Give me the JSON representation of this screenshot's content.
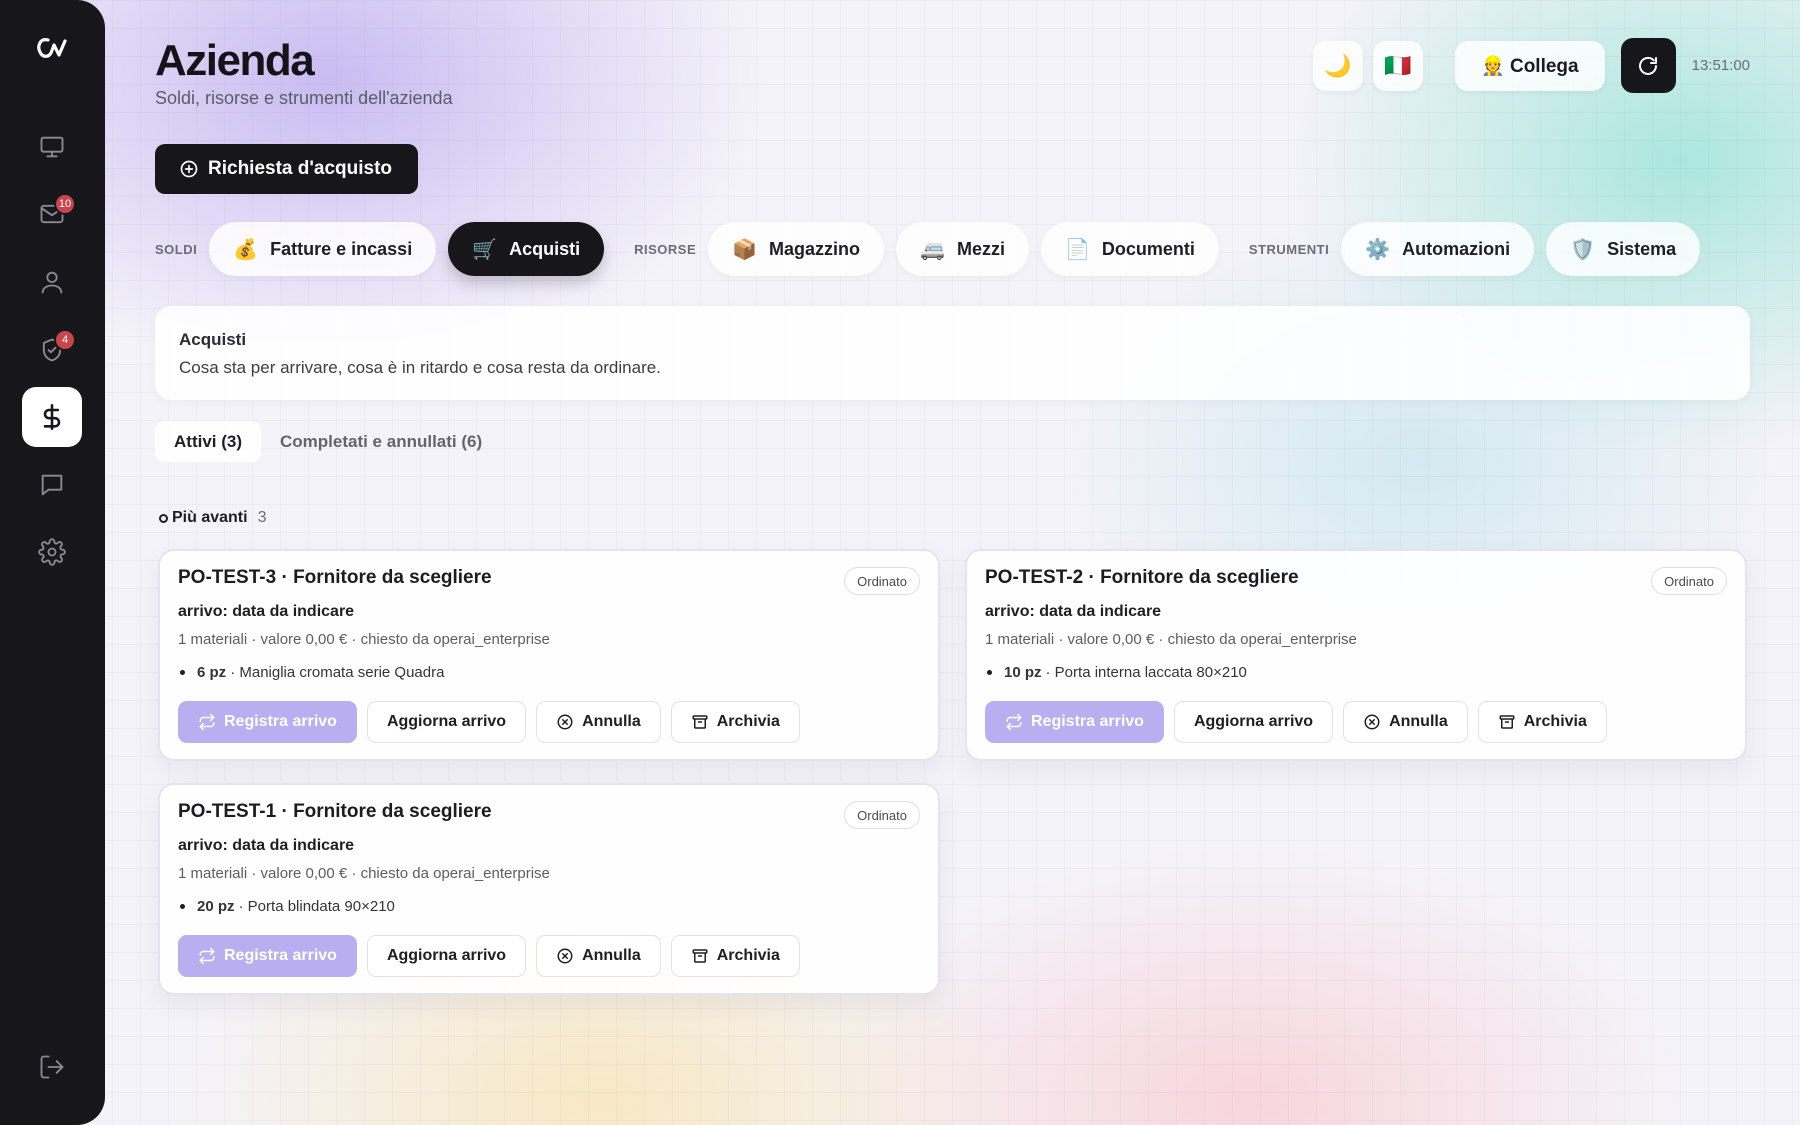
{
  "header": {
    "title": "Azienda",
    "subtitle": "Soldi, risorse e strumenti dell'azienda",
    "theme_icon": "moon-icon",
    "language_flag": "🇮🇹",
    "connect_label": "👷 Collega",
    "time": "13:51:00"
  },
  "sidebar": {
    "items": [
      {
        "name": "monitor-icon"
      },
      {
        "name": "mail-icon",
        "badge": "10"
      },
      {
        "name": "user-icon"
      },
      {
        "name": "shield-check-icon",
        "badge": "4"
      },
      {
        "name": "dollar-icon",
        "active": true
      },
      {
        "name": "chat-icon"
      },
      {
        "name": "gear-icon"
      }
    ],
    "logout_icon": "logout-icon"
  },
  "primary_action": "Richiesta d'acquisto",
  "tab_groups": {
    "soldi": "SOLDI",
    "risorse": "RISORSE",
    "strumenti": "STRUMENTI"
  },
  "tabs": [
    {
      "emoji": "💰",
      "label": "Fatture e incassi"
    },
    {
      "emoji": "🛒",
      "label": "Acquisti",
      "active": true
    },
    {
      "emoji": "📦",
      "label": "Magazzino"
    },
    {
      "emoji": "🚐",
      "label": "Mezzi"
    },
    {
      "emoji": "📄",
      "label": "Documenti"
    },
    {
      "emoji": "⚙️",
      "label": "Automazioni"
    },
    {
      "emoji": "🛡️",
      "label": "Sistema"
    }
  ],
  "info": {
    "title": "Acquisti",
    "description": "Cosa sta per arrivare, cosa è in ritardo e cosa resta da ordinare."
  },
  "subtabs": [
    {
      "label": "Attivi (3)",
      "active": true
    },
    {
      "label": "Completati e annullati (6)"
    }
  ],
  "section": {
    "label": "Più avanti",
    "count": "3"
  },
  "actions": {
    "register": "Registra arrivo",
    "update": "Aggiorna arrivo",
    "cancel": "Annulla",
    "archive": "Archivia"
  },
  "orders": [
    {
      "title": "PO-TEST-3 · Fornitore da scegliere",
      "status": "Ordinato",
      "arrival": "arrivo: data da indicare",
      "meta": "1 materiali · valore 0,00 € · chiesto da operai_enterprise",
      "item_qty": "6 pz",
      "item_desc": "· Maniglia cromata serie Quadra"
    },
    {
      "title": "PO-TEST-2 · Fornitore da scegliere",
      "status": "Ordinato",
      "arrival": "arrivo: data da indicare",
      "meta": "1 materiali · valore 0,00 € · chiesto da operai_enterprise",
      "item_qty": "10 pz",
      "item_desc": "· Porta interna laccata 80×210"
    },
    {
      "title": "PO-TEST-1 · Fornitore da scegliere",
      "status": "Ordinato",
      "arrival": "arrivo: data da indicare",
      "meta": "1 materiali · valore 0,00 € · chiesto da operai_enterprise",
      "item_qty": "20 pz",
      "item_desc": "· Porta blindata 90×210"
    }
  ],
  "colors": {
    "primary_dark": "#17171b",
    "accent_lilac": "#b9aef0",
    "badge_red": "#c8454a"
  }
}
